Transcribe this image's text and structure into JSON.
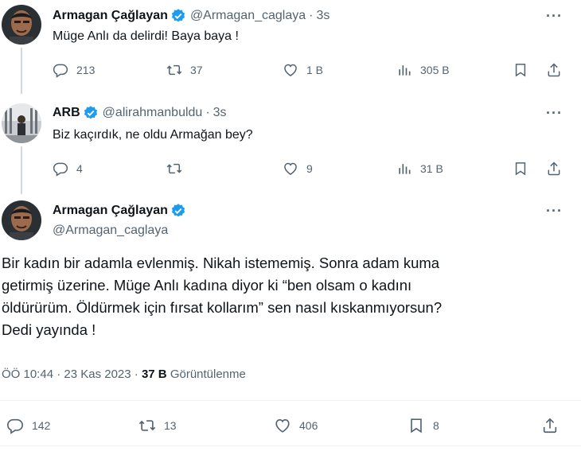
{
  "tweet1": {
    "display_name": "Armagan Çağlayan",
    "handle": "@Armagan_caglaya",
    "separator": "·",
    "time": "3s",
    "text": "Müge Anlı da delirdi! Baya baya !",
    "replies": "213",
    "retweets": "37",
    "likes": "1 B",
    "views": "305 B"
  },
  "tweet2": {
    "display_name": "ARB",
    "handle": "@alirahmanbuldu",
    "separator": "·",
    "time": "3s",
    "text": "Biz kaçırdık, ne oldu Armağan bey?",
    "replies": "4",
    "retweets": "",
    "likes": "9",
    "views": "31 B"
  },
  "main": {
    "display_name": "Armagan Çağlayan",
    "handle": "@Armagan_caglaya",
    "text_lines": [
      "Bir kadın bir adamla evlenmiş. Nikah istememiş. Sonra adam kuma",
      "getirmiş üzerine. Müge Anlı kadına diyor ki “ben olsam o kadını",
      "öldürürüm. Öldürmek için  fırsat kollarım” sen nasıl kıskanmıyorsun?",
      "Dedi yayında !"
    ],
    "timestamp": "ÖÖ 10:44 · 23 Kas 2023 ·",
    "views_count": "37 B",
    "views_label": "Görüntülenme",
    "replies": "142",
    "retweets": "13",
    "likes": "406",
    "bookmarks": "8"
  },
  "more_label": "···",
  "icons": {
    "reply": "reply-icon",
    "retweet": "retweet-icon",
    "like": "heart-icon",
    "views": "views-chart-icon",
    "bookmark": "bookmark-icon",
    "share": "share-icon",
    "verified": "verified-badge-icon",
    "more": "more-dots-icon"
  },
  "colors": {
    "text": "#0f1419",
    "secondary": "#536471",
    "verified": "#1d9bf0",
    "line": "#cfd9de"
  }
}
